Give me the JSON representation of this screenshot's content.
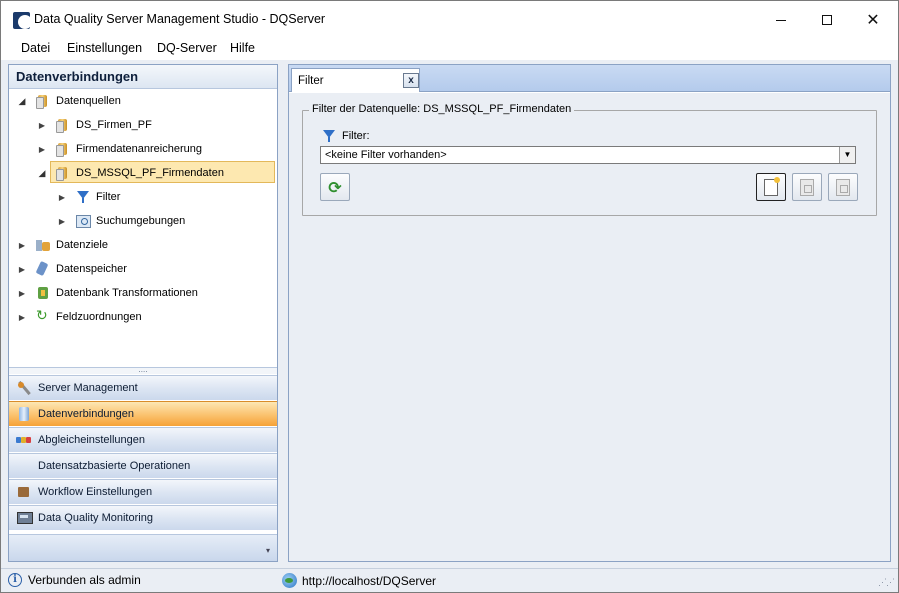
{
  "window": {
    "title": "Data Quality Server Management Studio - DQServer",
    "controls": {
      "minimize": "—",
      "maximize": "",
      "close": "✕"
    }
  },
  "menu": [
    "Datei",
    "Einstellungen",
    "DQ-Server",
    "Hilfe"
  ],
  "left_panel": {
    "header": "Datenverbindungen",
    "tree": [
      {
        "label": "Datenquellen",
        "icon": "database-icon",
        "expanded": true
      },
      {
        "label": "DS_Firmen_PF",
        "icon": "database-icon"
      },
      {
        "label": "Firmendatenanreicherung",
        "icon": "database-icon"
      },
      {
        "label": "DS_MSSQL_PF_Firmendaten",
        "icon": "database-icon",
        "selected": true,
        "expanded": true
      },
      {
        "label": "Filter",
        "icon": "filter-icon"
      },
      {
        "label": "Suchumgebungen",
        "icon": "search-icon"
      },
      {
        "label": "Datenziele",
        "icon": "target-icon"
      },
      {
        "label": "Datenspeicher",
        "icon": "storage-icon"
      },
      {
        "label": "Datenbank Transformationen",
        "icon": "transformation-icon"
      },
      {
        "label": "Feldzuordnungen",
        "icon": "mapping-icon"
      }
    ],
    "splitter": "....",
    "nav_buttons": [
      {
        "label": "Server Management",
        "icon": "wrench-icon"
      },
      {
        "label": "Datenverbindungen",
        "icon": "database-icon",
        "active": true
      },
      {
        "label": "Abgleicheinstellungen",
        "icon": "settings-icon"
      },
      {
        "label": "Datensatzbasierte Operationen",
        "icon": "tree-icon"
      },
      {
        "label": "Workflow Einstellungen",
        "icon": "box-icon"
      },
      {
        "label": "Data Quality Monitoring",
        "icon": "monitor-icon"
      }
    ],
    "footer_arrow": "▾"
  },
  "right_panel": {
    "tab": {
      "label": "Filter",
      "close": "x"
    },
    "group_title": "Filter der Datenquelle: DS_MSSQL_PF_Firmendaten",
    "filter_label": "Filter:",
    "filter_select": "<keine Filter vorhanden>",
    "select_arrow": "▼",
    "refresh_glyph": "⟳"
  },
  "status": {
    "left": "Verbunden als admin",
    "info_glyph": "i",
    "right": "http://localhost/DQServer",
    "grip": "⋰⋰"
  },
  "colors": {
    "accent": "#fbc574",
    "panel_border": "#8ba2c4",
    "selection": "#fde8b0",
    "tab_strip": "#c9daf3"
  }
}
